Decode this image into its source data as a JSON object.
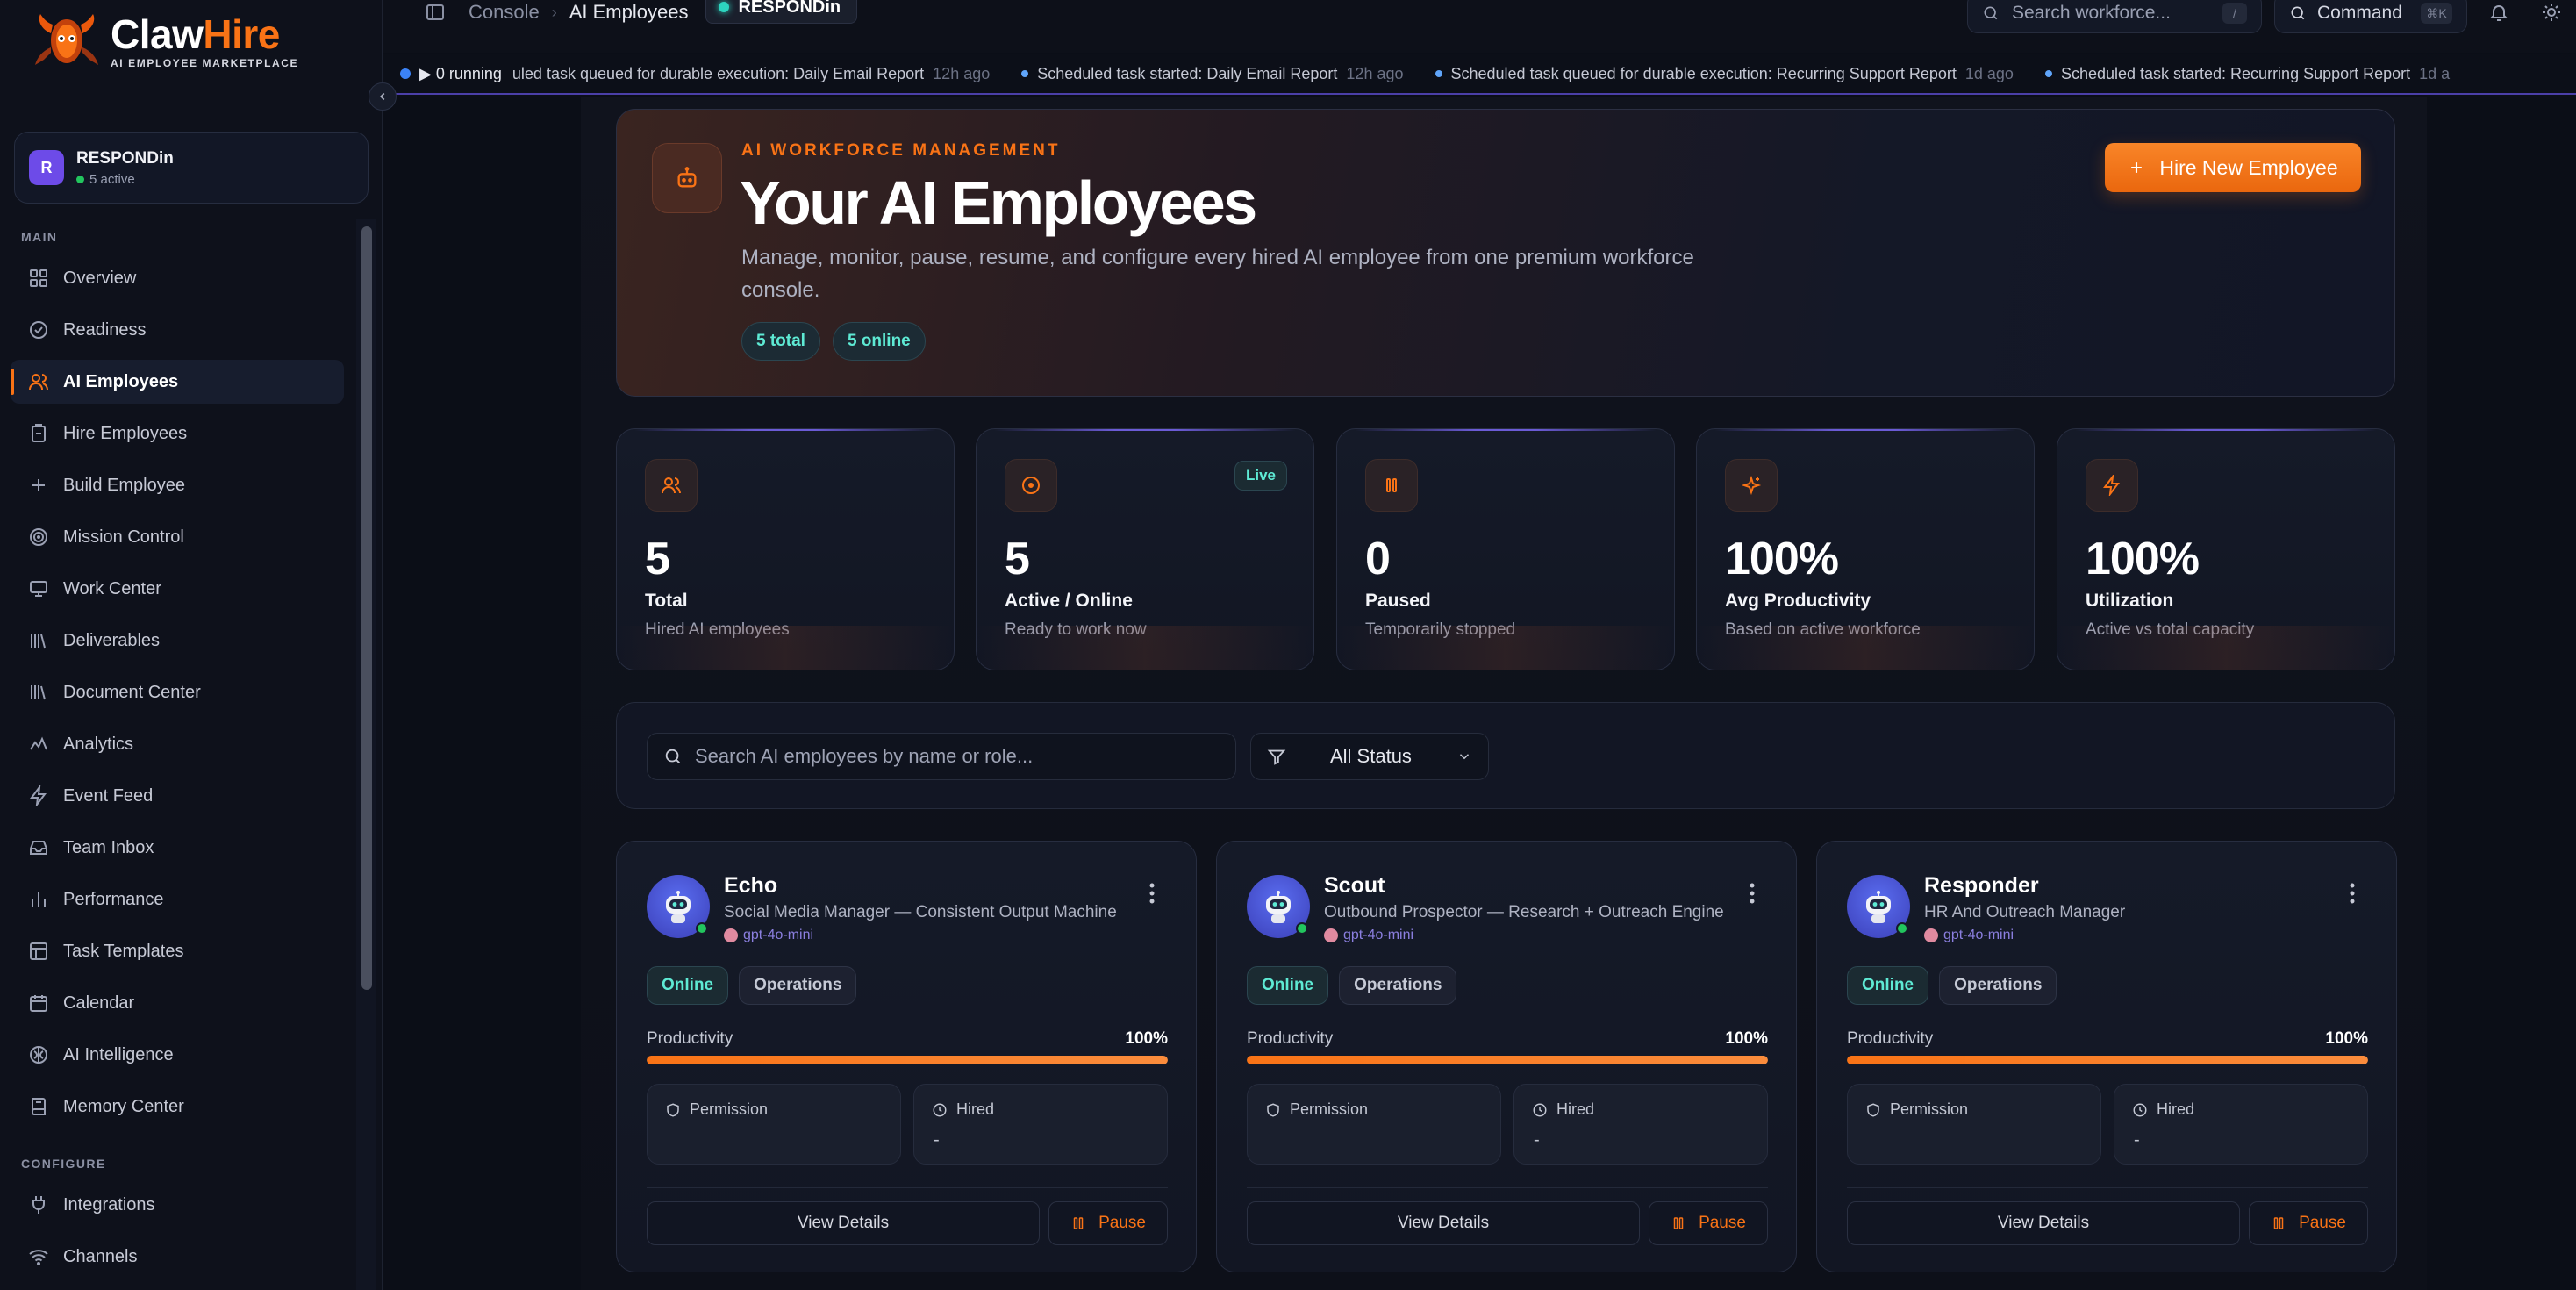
{
  "brand": {
    "name_main": "Claw",
    "name_accent": "Hire",
    "tagline": "AI EMPLOYEE MARKETPLACE"
  },
  "org": {
    "initial": "R",
    "name": "RESPONDin",
    "status": "5 active"
  },
  "sidebar": {
    "main_label": "MAIN",
    "configure_label": "CONFIGURE",
    "items": [
      {
        "label": "Overview",
        "icon": "grid-icon"
      },
      {
        "label": "Readiness",
        "icon": "check-circle-icon"
      },
      {
        "label": "AI Employees",
        "icon": "users-icon",
        "active": true
      },
      {
        "label": "Hire Employees",
        "icon": "clipboard-icon"
      },
      {
        "label": "Build Employee",
        "icon": "plus-icon"
      },
      {
        "label": "Mission Control",
        "icon": "target-icon"
      },
      {
        "label": "Work Center",
        "icon": "monitor-icon"
      },
      {
        "label": "Deliverables",
        "icon": "library-icon"
      },
      {
        "label": "Document Center",
        "icon": "library-icon"
      },
      {
        "label": "Analytics",
        "icon": "activity-icon"
      },
      {
        "label": "Event Feed",
        "icon": "bolt-icon"
      },
      {
        "label": "Team Inbox",
        "icon": "inbox-icon"
      },
      {
        "label": "Performance",
        "icon": "bar-chart-icon"
      },
      {
        "label": "Task Templates",
        "icon": "template-icon"
      },
      {
        "label": "Calendar",
        "icon": "calendar-icon"
      },
      {
        "label": "AI Intelligence",
        "icon": "brain-icon"
      },
      {
        "label": "Memory Center",
        "icon": "book-icon"
      }
    ],
    "config_items": [
      {
        "label": "Integrations",
        "icon": "plug-icon"
      },
      {
        "label": "Channels",
        "icon": "wifi-icon"
      }
    ]
  },
  "topbar": {
    "crumb_console": "Console",
    "crumb_page": "AI Employees",
    "crumb_org": "RESPONDin",
    "search_placeholder": "Search workforce...",
    "search_kbd": "/",
    "command_label": "Command",
    "command_kbd": "⌘K"
  },
  "ticker": {
    "running": "▶ 0 running",
    "events": [
      {
        "text": "uled task queued for durable execution: Daily Email Report",
        "time": "12h ago"
      },
      {
        "text": "Scheduled task started: Daily Email Report",
        "time": "12h ago"
      },
      {
        "text": "Scheduled task queued for durable execution: Recurring Support Report",
        "time": "1d ago"
      },
      {
        "text": "Scheduled task started: Recurring Support Report",
        "time": "1d a"
      }
    ]
  },
  "hero": {
    "kicker": "AI WORKFORCE MANAGEMENT",
    "title": "Your AI Employees",
    "description": "Manage, monitor, pause, resume, and configure every hired AI employee from one premium workforce console.",
    "pill_total": "5 total",
    "pill_online": "5 online",
    "hire_button": "Hire New Employee"
  },
  "stats": [
    {
      "value": "5",
      "label": "Total",
      "sub": "Hired AI employees",
      "icon": "users-icon"
    },
    {
      "value": "5",
      "label": "Active / Online",
      "sub": "Ready to work now",
      "icon": "play-circle-icon",
      "badge": "Live"
    },
    {
      "value": "0",
      "label": "Paused",
      "sub": "Temporarily stopped",
      "icon": "pause-icon"
    },
    {
      "value": "100%",
      "label": "Avg Productivity",
      "sub": "Based on active workforce",
      "icon": "sparkles-icon"
    },
    {
      "value": "100%",
      "label": "Utilization",
      "sub": "Active vs total capacity",
      "icon": "bolt-icon"
    }
  ],
  "filters": {
    "search_placeholder": "Search AI employees by name or role...",
    "status_value": "All Status"
  },
  "employees": [
    {
      "name": "Echo",
      "role": "Social Media Manager — Consistent Output Machine",
      "model": "gpt-4o-mini",
      "status": "Online",
      "dept": "Operations",
      "productivity_label": "Productivity",
      "productivity": "100%",
      "productivity_fraction": 1.0,
      "permission_label": "Permission",
      "hired_label": "Hired",
      "hired_value": "-",
      "details_label": "View Details",
      "pause_label": "Pause"
    },
    {
      "name": "Scout",
      "role": "Outbound Prospector — Research + Outreach Engine",
      "model": "gpt-4o-mini",
      "status": "Online",
      "dept": "Operations",
      "productivity_label": "Productivity",
      "productivity": "100%",
      "productivity_fraction": 1.0,
      "permission_label": "Permission",
      "hired_label": "Hired",
      "hired_value": "-",
      "details_label": "View Details",
      "pause_label": "Pause"
    },
    {
      "name": "Responder",
      "role": "HR And Outreach Manager",
      "model": "gpt-4o-mini",
      "status": "Online",
      "dept": "Operations",
      "productivity_label": "Productivity",
      "productivity": "100%",
      "productivity_fraction": 1.0,
      "permission_label": "Permission",
      "hired_label": "Hired",
      "hired_value": "-",
      "details_label": "View Details",
      "pause_label": "Pause"
    }
  ],
  "colors": {
    "accent": "#f97316",
    "teal": "#5eead4",
    "background": "#0b0e17"
  }
}
